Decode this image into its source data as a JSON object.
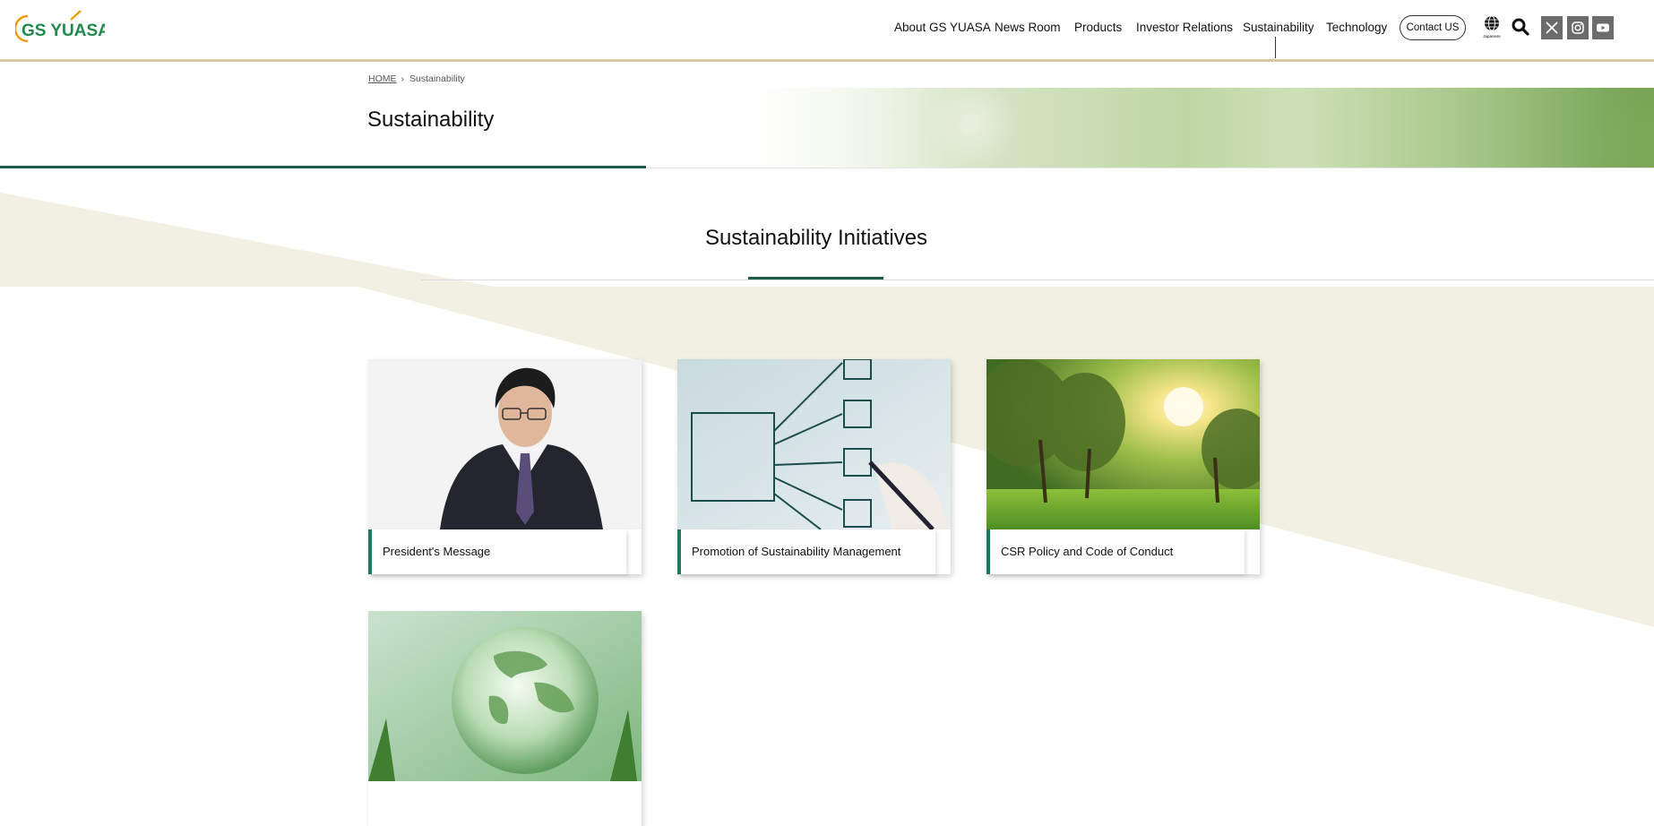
{
  "header": {
    "logo_text": "GS YUASA",
    "nav": [
      {
        "label": "About GS YUASA",
        "name": "nav-about"
      },
      {
        "label": "News Room",
        "name": "nav-news-room"
      },
      {
        "label": "Products",
        "name": "nav-products"
      },
      {
        "label": "Investor Relations",
        "name": "nav-investor-relations"
      },
      {
        "label": "Sustainability",
        "name": "nav-sustainability",
        "active": true
      },
      {
        "label": "Technology",
        "name": "nav-technology"
      }
    ],
    "contact_label": "Contact US",
    "language_label": "Japanese",
    "icons": [
      "globe-icon",
      "search-icon",
      "x-icon",
      "instagram-icon",
      "youtube-icon"
    ]
  },
  "breadcrumb": {
    "home": "HOME",
    "current": "Sustainability"
  },
  "page": {
    "title": "Sustainability",
    "section_title": "Sustainability Initiatives"
  },
  "cards": [
    {
      "label": "President's Message",
      "image": "president-photo"
    },
    {
      "label": "Promotion of Sustainability Management",
      "image": "flowchart-drawing"
    },
    {
      "label": "CSR Policy and Code of Conduct",
      "image": "sunlit-forest"
    },
    {
      "label": "",
      "image": "glass-globe"
    }
  ],
  "colors": {
    "accent_green": "#1e5d4a",
    "card_accent": "#1e7a5e",
    "header_border": "#d8c9a3",
    "beige_deco": "#f2efe3",
    "logo_green": "#1f8a4c",
    "logo_orange": "#f39800"
  }
}
